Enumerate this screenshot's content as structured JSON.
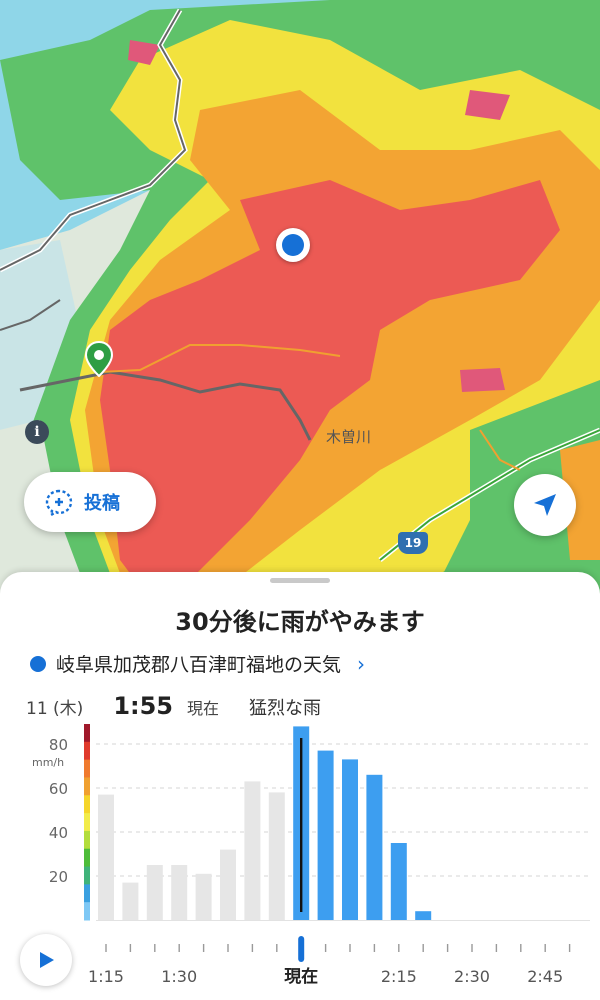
{
  "map": {
    "labels": {
      "river": "木曽川",
      "route": "19"
    }
  },
  "buttons": {
    "post_label": "投稿"
  },
  "sheet": {
    "headline": "30分後に雨がやみます",
    "location": "岐阜県加茂郡八百津町福地の天気",
    "date": "11 (木)",
    "time": "1:55",
    "now_label": "現在",
    "status": "猛烈な雨"
  },
  "colors": {
    "accent": "#1670d6",
    "bar_forecast": "#3d9ef0",
    "bar_past": "#e6e6e6",
    "current_marker": "#1670d6"
  },
  "chart_data": {
    "type": "bar",
    "unit": "mm/h",
    "ylim": [
      0,
      90
    ],
    "yticks": [
      {
        "value": 80,
        "label": "80"
      },
      {
        "value": 60,
        "label": "60"
      },
      {
        "value": 40,
        "label": "40"
      },
      {
        "value": 20,
        "label": "20"
      }
    ],
    "grid": true,
    "bars": [
      {
        "time": "1:15",
        "value": 57,
        "kind": "past"
      },
      {
        "time": "1:20",
        "value": 17,
        "kind": "past"
      },
      {
        "time": "1:25",
        "value": 25,
        "kind": "past"
      },
      {
        "time": "1:30",
        "value": 25,
        "kind": "past"
      },
      {
        "time": "1:35",
        "value": 21,
        "kind": "past"
      },
      {
        "time": "1:40",
        "value": 32,
        "kind": "past"
      },
      {
        "time": "1:45",
        "value": 63,
        "kind": "past"
      },
      {
        "time": "1:50",
        "value": 58,
        "kind": "past"
      },
      {
        "time": "1:55",
        "value": 88,
        "kind": "forecast"
      },
      {
        "time": "2:00",
        "value": 77,
        "kind": "forecast"
      },
      {
        "time": "2:05",
        "value": 73,
        "kind": "forecast"
      },
      {
        "time": "2:10",
        "value": 66,
        "kind": "forecast"
      },
      {
        "time": "2:15",
        "value": 35,
        "kind": "forecast"
      },
      {
        "time": "2:20",
        "value": 4,
        "kind": "forecast"
      },
      {
        "time": "2:25",
        "value": 0,
        "kind": "forecast"
      },
      {
        "time": "2:30",
        "value": 0,
        "kind": "forecast"
      },
      {
        "time": "2:35",
        "value": 0,
        "kind": "forecast"
      },
      {
        "time": "2:40",
        "value": 0,
        "kind": "forecast"
      },
      {
        "time": "2:45",
        "value": 0,
        "kind": "forecast"
      },
      {
        "time": "2:50",
        "value": 0,
        "kind": "forecast"
      }
    ],
    "current_index": 8,
    "xtick_labels": [
      {
        "index": 0,
        "label": "1:15"
      },
      {
        "index": 3,
        "label": "1:30"
      },
      {
        "index": 8,
        "label": "現在"
      },
      {
        "index": 12,
        "label": "2:15"
      },
      {
        "index": 15,
        "label": "2:30"
      },
      {
        "index": 18,
        "label": "2:45"
      }
    ],
    "color_scale": [
      "#a0182a",
      "#e03a2c",
      "#f07a2e",
      "#f0a030",
      "#f5d52a",
      "#f2ec4a",
      "#b3dd3c",
      "#4ebd3a",
      "#40b37a",
      "#3aa0e0",
      "#7ec8f5"
    ]
  }
}
